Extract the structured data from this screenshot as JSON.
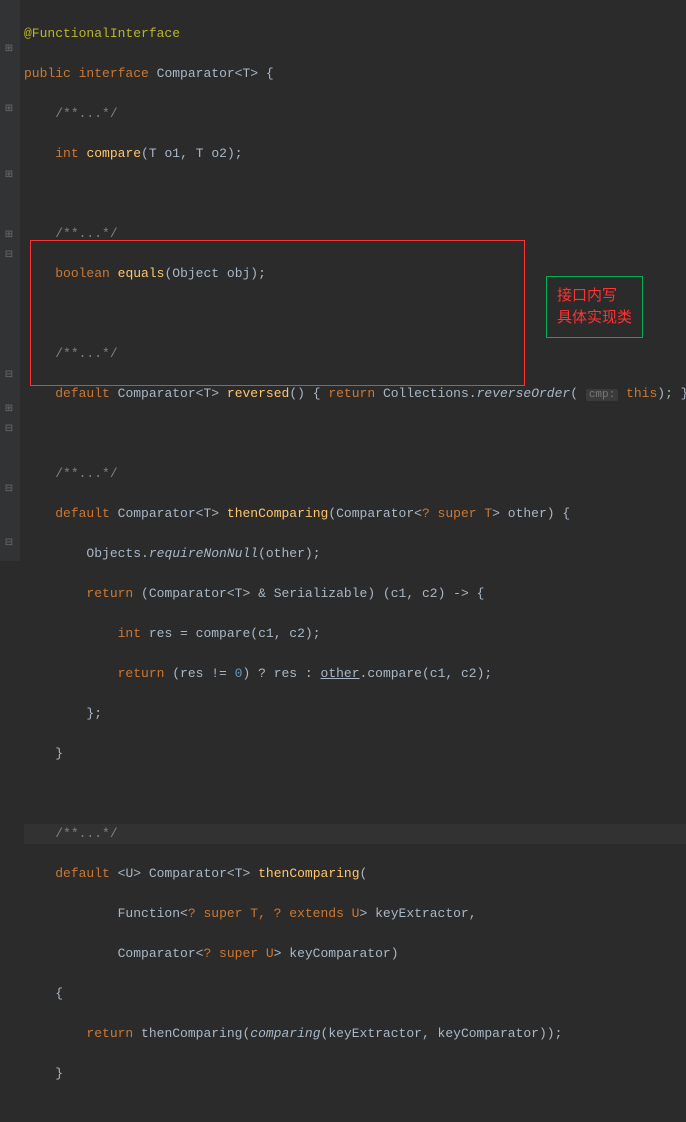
{
  "annotation_box": {
    "line1": "接口内写",
    "line2": "具体实现类"
  },
  "code": {
    "l1_ann": "@FunctionalInterface",
    "l2_kw_public": "public",
    "l2_kw_interface": "interface",
    "l2_type": "Comparator",
    "l2_generic": "T",
    "fold_comment": "/**...*/",
    "l4_kw_int": "int",
    "l4_method": "compare",
    "l4_p1t": "T",
    "l4_p1n": "o1",
    "l4_p2t": "T",
    "l4_p2n": "o2",
    "l7_kw_boolean": "boolean",
    "l7_method": "equals",
    "l7_pt": "Object",
    "l7_pn": "obj",
    "l10_kw_default": "default",
    "l10_type": "Comparator",
    "l10_gen": "T",
    "l10_method": "reversed",
    "l10_kw_return": "return",
    "l10_call_cls": "Collections",
    "l10_call_m": "reverseOrder",
    "l10_hint": "cmp:",
    "l10_kw_this": "this",
    "l13_kw_default": "default",
    "l13_type": "Comparator",
    "l13_gen": "T",
    "l13_method": "thenComparing",
    "l13_pt": "Comparator",
    "l13_pwild": "? super T",
    "l13_pn": "other",
    "l14_cls": "Objects",
    "l14_m": "requireNonNull",
    "l14_arg": "other",
    "l15_kw_return": "return",
    "l15_cast1": "Comparator",
    "l15_castg": "T",
    "l15_cast2": "Serializable",
    "l15_lam1": "c1",
    "l15_lam2": "c2",
    "l16_kw_int": "int",
    "l16_var": "res",
    "l16_m": "compare",
    "l16_a1": "c1",
    "l16_a2": "c2",
    "l17_kw_return": "return",
    "l17_var": "res",
    "l17_num": "0",
    "l17_v2": "res",
    "l17_obj": "other",
    "l17_m": "compare",
    "l17_a1": "c1",
    "l17_a2": "c2",
    "l22_kw_default": "default",
    "l22_gen": "U",
    "l22_type": "Comparator",
    "l22_gen2": "T",
    "l22_method": "thenComparing",
    "l23_pt": "Function",
    "l23_pwild": "? super T, ? extends U",
    "l23_pn": "keyExtractor",
    "l24_pt": "Comparator",
    "l24_pwild": "? super U",
    "l24_pn": "keyComparator",
    "l26_kw_return": "return",
    "l26_m1": "thenComparing",
    "l26_m2": "comparing",
    "l26_a1": "keyExtractor",
    "l26_a2": "keyComparator"
  }
}
